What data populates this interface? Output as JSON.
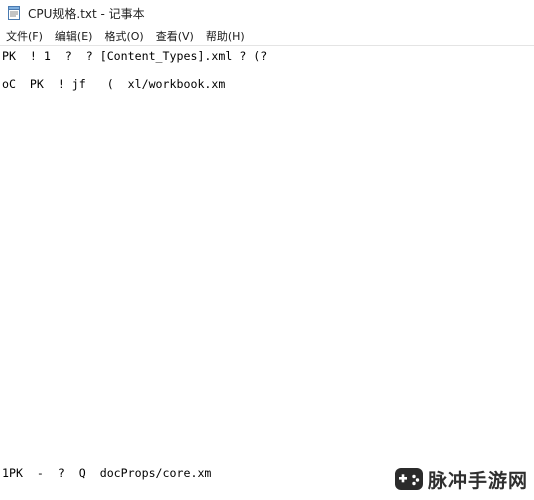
{
  "window": {
    "title": "CPU规格.txt - 记事本",
    "icon": "notepad-icon"
  },
  "menu": {
    "items": [
      {
        "label": "文件(F)"
      },
      {
        "label": "编辑(E)"
      },
      {
        "label": "格式(O)"
      },
      {
        "label": "查看(V)"
      },
      {
        "label": "帮助(H)"
      }
    ]
  },
  "editor": {
    "lines": [
      "PK  ! 1  ?  ? [Content_Types].xml ? (?",
      "",
      "oC  PK  ! jf   (  xl/workbook.xm",
      "",
      "",
      "",
      "",
      "",
      "",
      "",
      "",
      "",
      "",
      "",
      "",
      "",
      "",
      "",
      "",
      "",
      "",
      "",
      "",
      "",
      "",
      "",
      "",
      "",
      "",
      "",
      "1PK  -  ?  Q  docProps/core.xm"
    ]
  },
  "watermark": {
    "text": "脉冲手游网",
    "logo": "game-controller-logo-icon"
  }
}
